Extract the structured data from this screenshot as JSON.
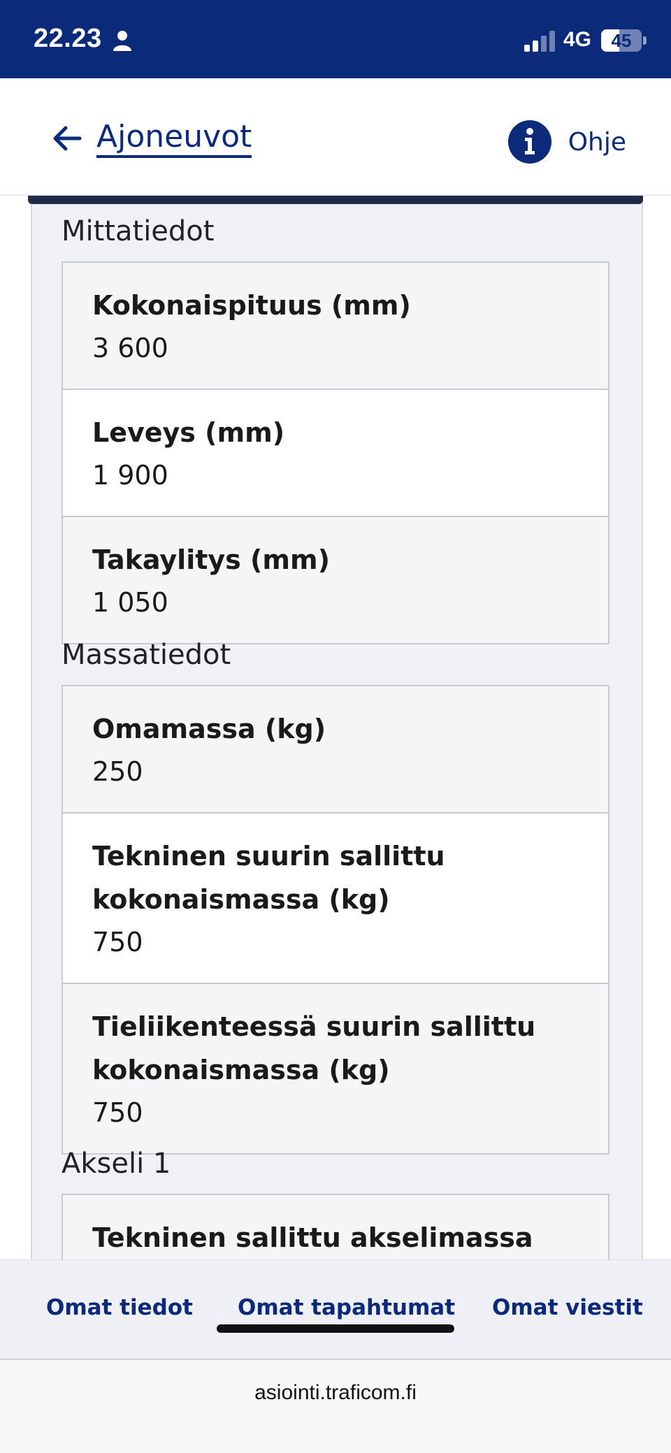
{
  "status_bar": {
    "time": "22.23",
    "network": "4G",
    "battery": "45",
    "battery_level": 0.45
  },
  "header": {
    "back_label": "Ajoneuvot",
    "help_label": "Ohje"
  },
  "sections": [
    {
      "heading": "Mittatiedot",
      "rows": [
        {
          "label": "Kokonaispituus (mm)",
          "value": "3 600"
        },
        {
          "label": "Leveys (mm)",
          "value": "1 900"
        },
        {
          "label": "Takaylitys (mm)",
          "value": "1 050"
        }
      ]
    },
    {
      "heading": "Massatiedot",
      "rows": [
        {
          "label": "Omamassa (kg)",
          "value": "250"
        },
        {
          "label": "Tekninen suurin sallittu kokonaismassa (kg)",
          "value": "750"
        },
        {
          "label": "Tieliikenteessä suurin sallittu kokonaismassa (kg)",
          "value": "750"
        }
      ]
    },
    {
      "heading": "Akseli 1",
      "rows": [
        {
          "label": "Tekninen sallittu akselimassa",
          "value": ""
        }
      ]
    }
  ],
  "bottom_nav": {
    "items": [
      "Omat tiedot",
      "Omat tapahtumat",
      "Omat viestit"
    ]
  },
  "browser": {
    "url": "asiointi.traficom.fi"
  },
  "colors": {
    "brand": "#0b2a7a",
    "panel_bg": "#f0f1f4"
  }
}
